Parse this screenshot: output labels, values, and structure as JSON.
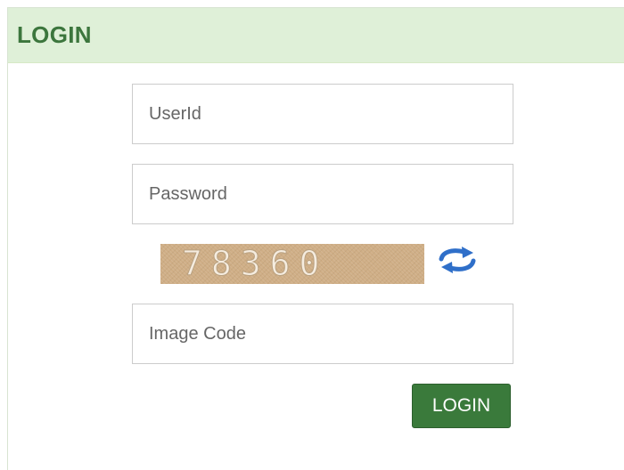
{
  "panel": {
    "title": "LOGIN"
  },
  "form": {
    "userid_placeholder": "UserId",
    "password_placeholder": "Password",
    "captcha_text": "78360",
    "refresh_icon": "refresh-icon",
    "imagecode_placeholder": "Image Code",
    "login_label": "LOGIN"
  },
  "colors": {
    "header_bg": "#dff0d8",
    "title_text": "#3c763d",
    "button_bg": "#3a7a3b",
    "captcha_bg": "#cfae86",
    "refresh_icon": "#2f6fc9"
  }
}
